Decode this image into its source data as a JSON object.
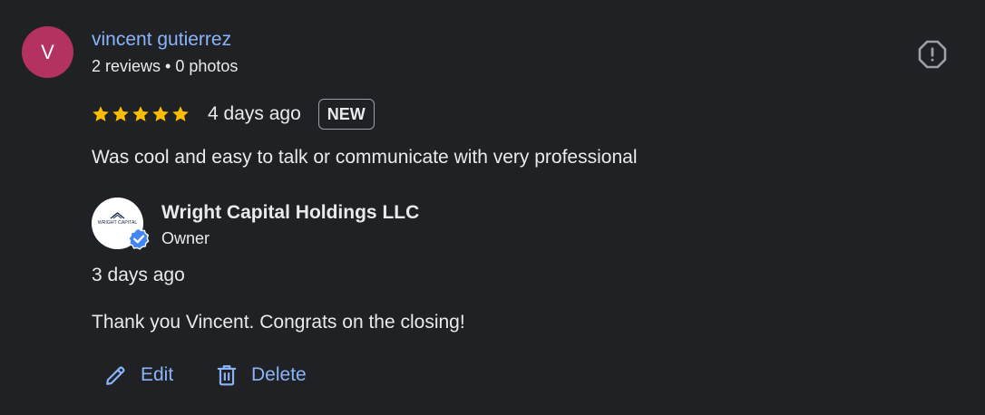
{
  "review": {
    "avatar_letter": "V",
    "reviewer_name": "vincent gutierrez",
    "reviewer_meta": "2 reviews • 0 photos",
    "rating": 5,
    "rating_max": 5,
    "date": "4 days ago",
    "badge": "NEW",
    "text": "Was cool and easy to talk or communicate with very professional"
  },
  "reply": {
    "logo_text": "WRIGHT CAPITAL",
    "owner_name": "Wright Capital Holdings LLC",
    "owner_role": "Owner",
    "date": "3 days ago",
    "text": "Thank you Vincent. Congrats on the closing!"
  },
  "actions": {
    "edit_label": "Edit",
    "delete_label": "Delete"
  },
  "icons": {
    "report": "report-icon",
    "star": "star-icon",
    "verified": "verified-badge-icon",
    "edit": "pencil-icon",
    "delete": "trash-icon"
  },
  "colors": {
    "background": "#202124",
    "avatar": "#b33262",
    "link": "#8ab4f8",
    "star": "#fbbc04",
    "verified": "#4285f4",
    "text": "#e8eaed"
  }
}
